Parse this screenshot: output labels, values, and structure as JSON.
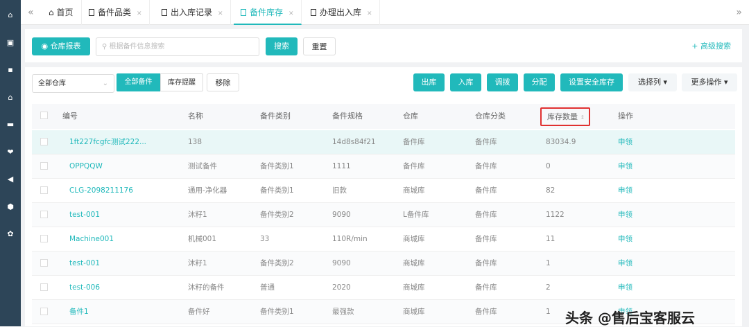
{
  "sidebar": {
    "icons": [
      "home-icon",
      "clipboard-icon",
      "contact-icon",
      "warehouse-icon",
      "monitor-icon",
      "handshake-icon",
      "megaphone-icon",
      "shield-icon",
      "gear-icon"
    ]
  },
  "tabs": [
    {
      "label": "首页",
      "closable": false
    },
    {
      "label": "备件品类",
      "closable": true
    },
    {
      "label": "出入库记录",
      "closable": true
    },
    {
      "label": "备件库存",
      "closable": true,
      "active": true
    },
    {
      "label": "办理出入库",
      "closable": true
    }
  ],
  "toolbar": {
    "report_label": "仓库报表",
    "search_placeholder": "根据备件信息搜索",
    "search_label": "搜索",
    "reset_label": "重置",
    "advanced_label": "+ 高级搜索"
  },
  "filters": {
    "warehouse": "全部仓库",
    "seg_all": "全部备件",
    "seg_alert": "库存提醒",
    "remove_label": "移除"
  },
  "actions": {
    "out": "出库",
    "in": "入库",
    "transfer": "调拨",
    "allocate": "分配",
    "safety": "设置安全库存",
    "columns": "选择列",
    "more": "更多操作"
  },
  "table": {
    "headers": [
      "编号",
      "名称",
      "备件类别",
      "备件规格",
      "仓库",
      "仓库分类",
      "库存数量",
      "操作"
    ],
    "rows": [
      [
        "1ft227fcgfc测试222...",
        "138",
        "",
        "14d8s84f21",
        "备件库",
        "备件库",
        "83034.9",
        "申领"
      ],
      [
        "OPPQQW",
        "测试备件",
        "备件类别1",
        "1111",
        "备件库",
        "备件库",
        "0",
        "申领"
      ],
      [
        "CLG-2098211176",
        "通用-净化器",
        "备件类别1",
        "旧款",
        "商城库",
        "备件库",
        "82",
        "申领"
      ],
      [
        "test-001",
        "沐籽1",
        "备件类别2",
        "9090",
        "L备件库",
        "备件库",
        "1122",
        "申领"
      ],
      [
        "Machine001",
        "机械001",
        "33",
        "110R/min",
        "商城库",
        "备件库",
        "11",
        "申领"
      ],
      [
        "test-001",
        "沐籽1",
        "备件类别2",
        "9090",
        "商城库",
        "备件库",
        "1",
        "申领"
      ],
      [
        "test-006",
        "沐籽的备件",
        "普通",
        "2020",
        "商城库",
        "备件库",
        "2",
        "申领"
      ],
      [
        "备件1",
        "备件好",
        "备件类别1",
        "最强款",
        "商城库",
        "备件库",
        "1",
        "申领"
      ]
    ]
  },
  "watermark": "头条 @售后宝客服云",
  "colors": {
    "accent": "#21b9bb",
    "sidebar": "#2d4558",
    "highlight": "#e03030"
  }
}
